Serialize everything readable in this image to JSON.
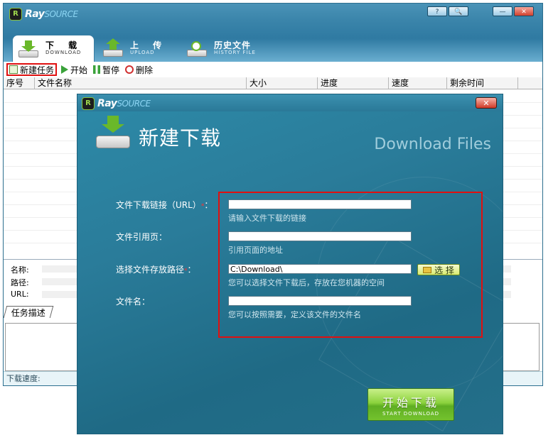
{
  "app": {
    "logo_main": "Ray",
    "logo_sub": "SOURCE",
    "window_buttons": [
      "?",
      "🔍",
      "—",
      "✕"
    ]
  },
  "tabs": [
    {
      "cn": "下 载",
      "en": "DOWNLOAD",
      "active": true
    },
    {
      "cn": "上 传",
      "en": "UPLOAD",
      "active": false
    },
    {
      "cn": "历史文件",
      "en": "HISTORY FILE",
      "active": false
    }
  ],
  "toolbar": {
    "new_task": "新建任务",
    "start": "开始",
    "pause": "暂停",
    "delete": "删除"
  },
  "table": {
    "columns": [
      "序号",
      "文件名称",
      "大小",
      "进度",
      "速度",
      "剩余时间"
    ]
  },
  "info": {
    "name_label": "名称:",
    "path_label": "路径:",
    "url_label": "URL:",
    "tab_label": "任务描述"
  },
  "status": {
    "speed_label": "下载速度:"
  },
  "dialog": {
    "logo_main": "Ray",
    "logo_sub": "SOURCE",
    "close": "✕",
    "heading": "新建下载",
    "subtitle": "Download Files",
    "url_label": "文件下载链接（URL）",
    "url_req": "*",
    "url_colon": "：",
    "url_value": "",
    "url_hint": "请输入文件下载的链接",
    "referer_label": "文件引用页：",
    "referer_value": "",
    "referer_hint": "引用页面的地址",
    "path_label": "选择文件存放路径",
    "path_req": "*",
    "path_colon": "：",
    "path_value": "C:\\Download\\",
    "path_hint": "您可以选择文件下载后，存放在您机器的空间",
    "browse": "选 择",
    "filename_label": "文件名：",
    "filename_value": "",
    "filename_hint": "您可以按照需要，定义该文件的文件名",
    "start_cn": "开始下载",
    "start_en": "START DOWNLOAD"
  }
}
